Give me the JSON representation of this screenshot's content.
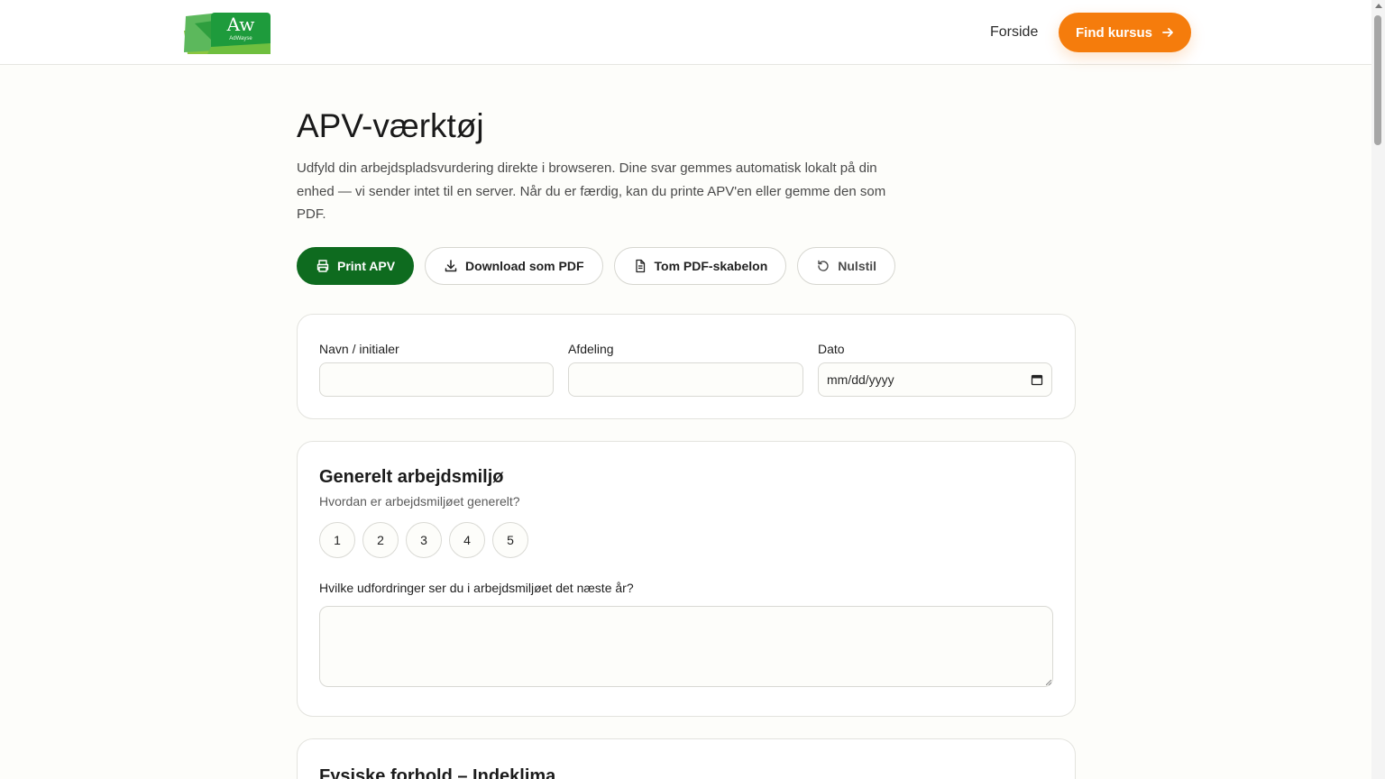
{
  "header": {
    "logo_text": "Aw",
    "logo_sub": "AdWayse",
    "nav_home": "Forside",
    "cta_label": "Find kursus",
    "brand_orange": "#f57c0c",
    "brand_green": "#0e6b1f"
  },
  "page": {
    "title": "APV-værktøj",
    "intro": "Udfyld din arbejdspladsvurdering direkte i browseren. Dine svar gemmes automatisk lokalt på din enhed — vi sender intet til en server. Når du er færdig, kan du printe APV'en eller gemme den som PDF."
  },
  "actions": {
    "print": "Print APV",
    "download": "Download som PDF",
    "template": "Tom PDF-skabelon",
    "reset": "Nulstil"
  },
  "info": {
    "name_label": "Navn / initialer",
    "name_value": "",
    "department_label": "Afdeling",
    "department_value": "",
    "date_label": "Dato",
    "date_placeholder": "mm/dd/yyyy"
  },
  "general": {
    "title": "Generelt arbejdsmiljø",
    "question": "Hvordan er arbejdsmiljøet generelt?",
    "scale": [
      "1",
      "2",
      "3",
      "4",
      "5"
    ],
    "challenges_label": "Hvilke udfordringer ser du i arbejdsmiljøet det næste år?",
    "challenges_value": ""
  },
  "physical": {
    "title": "Fysiske forhold – Indeklima"
  }
}
